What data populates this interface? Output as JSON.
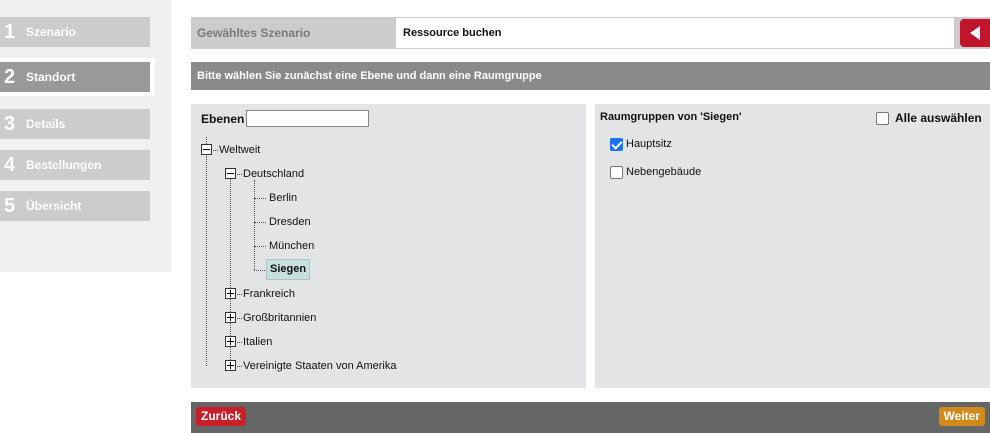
{
  "sidebar": {
    "steps": [
      {
        "num": "1",
        "label": "Szenario"
      },
      {
        "num": "2",
        "label": "Standort",
        "active": true
      },
      {
        "num": "3",
        "label": "Details"
      },
      {
        "num": "4",
        "label": "Bestellungen"
      },
      {
        "num": "5",
        "label": "Übersicht"
      }
    ]
  },
  "header": {
    "scenario_label": "Gewähltes Szenario",
    "scenario_value": "Ressource buchen"
  },
  "instruction": "Bitte wählen Sie zunächst eine Ebene und dann eine Raumgruppe",
  "tree": {
    "label": "Ebenen",
    "search_value": "",
    "nodes": {
      "weltweit": "Weltweit",
      "deutschland": "Deutschland",
      "berlin": "Berlin",
      "dresden": "Dresden",
      "muenchen": "München",
      "siegen": "Siegen",
      "frankreich": "Frankreich",
      "grossbritannien": "Großbritannien",
      "italien": "Italien",
      "usa": "Vereinigte Staaten von Amerika"
    },
    "selected": "Siegen"
  },
  "groups": {
    "title": "Raumgruppen von 'Siegen'",
    "select_all_label": "Alle auswählen",
    "select_all_checked": false,
    "items": [
      {
        "label": "Hauptsitz",
        "checked": true
      },
      {
        "label": "Nebengebäude",
        "checked": false
      }
    ]
  },
  "footer": {
    "back_label": "Zurück",
    "next_label": "Weiter"
  },
  "colors": {
    "accent_red": "#c0152b",
    "next_orange": "#d38a1d",
    "checkbox_blue": "#1a73e8"
  }
}
